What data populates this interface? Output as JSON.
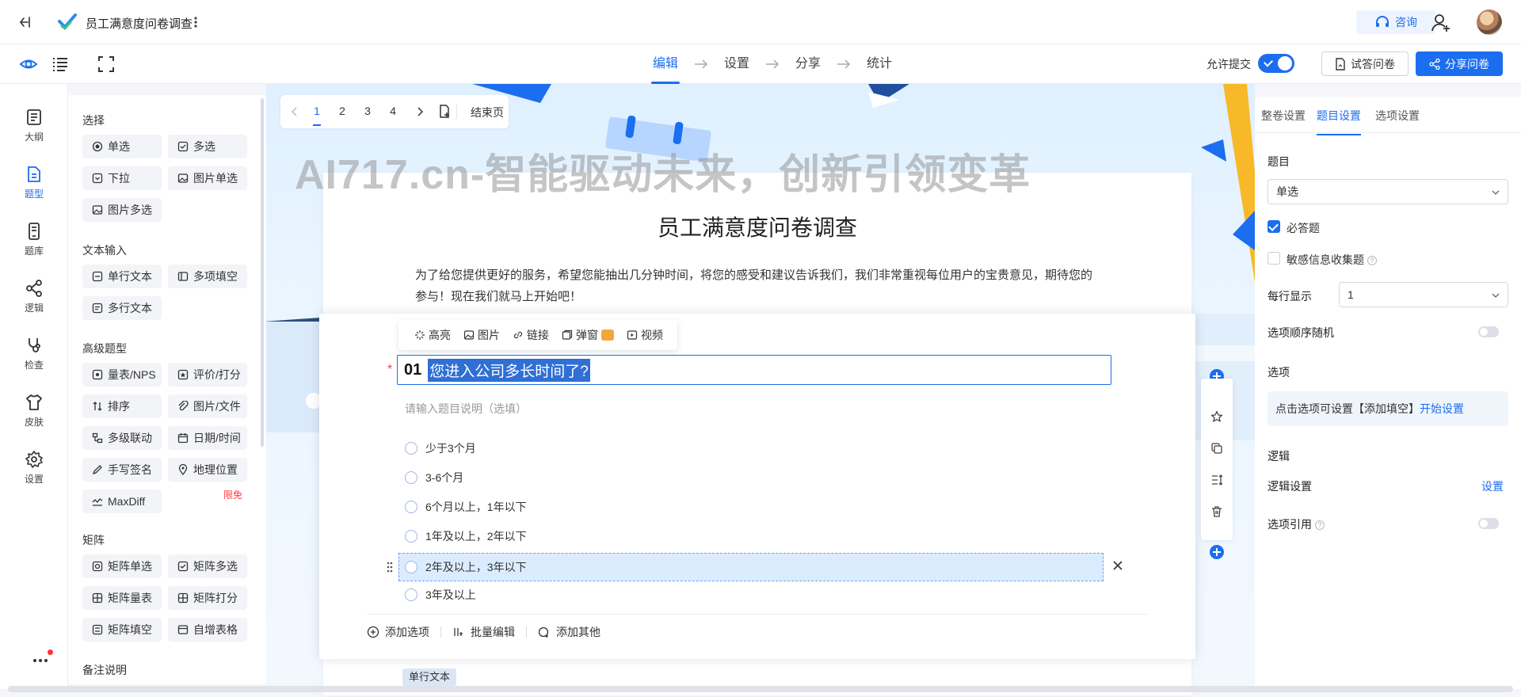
{
  "app": {
    "title": "员工满意度问卷调查"
  },
  "header": {
    "consult_label": "咨询",
    "steps": [
      "编辑",
      "设置",
      "分享",
      "统计"
    ],
    "allow_submit_label": "允许提交",
    "try_label": "试答问卷",
    "share_label": "分享问卷"
  },
  "rail": {
    "items": [
      "大纲",
      "题型",
      "题库",
      "逻辑",
      "检查",
      "皮肤",
      "设置"
    ]
  },
  "types": {
    "sections": [
      "选择",
      "文本输入",
      "高级题型",
      "矩阵",
      "备注说明"
    ],
    "choice": [
      "单选",
      "多选",
      "下拉",
      "图片单选",
      "图片多选"
    ],
    "text": [
      "单行文本",
      "多项填空",
      "多行文本"
    ],
    "advanced": [
      "量表/NPS",
      "评价/打分",
      "排序",
      "图片/文件",
      "多级联动",
      "日期/时间",
      "手写签名",
      "地理位置",
      "MaxDiff"
    ],
    "limit_badge": "限免",
    "matrix": [
      "矩阵单选",
      "矩阵多选",
      "矩阵量表",
      "矩阵打分",
      "矩阵填空",
      "自增表格"
    ]
  },
  "pagenav": {
    "pages": [
      "1",
      "2",
      "3",
      "4"
    ],
    "end_label": "结束页"
  },
  "watermark": "AI717.cn-智能驱动未来，创新引领变革",
  "survey": {
    "title": "员工满意度问卷调查",
    "description": "为了给您提供更好的服务，希望您能抽出几分钟时间，将您的感受和建议告诉我们，我们非常重视每位用户的宝贵意见，期待您的参与！现在我们就马上开始吧！"
  },
  "question": {
    "toolbar": [
      "高亮",
      "图片",
      "链接",
      "弹窗",
      "视频"
    ],
    "required_mark": "*",
    "number": "01",
    "text": "您进入公司多长时间了?",
    "desc_placeholder": "请输入题目说明（选填）",
    "options": [
      "少于3个月",
      "3-6个月",
      "6个月以上，1年以下",
      "1年及以上，2年以下",
      "2年及以上，3年以下",
      "3年及以上"
    ],
    "footer": [
      "添加选项",
      "批量编辑",
      "添加其他"
    ],
    "next_tag": "单行文本"
  },
  "settings": {
    "tabs": [
      "整卷设置",
      "题目设置",
      "选项设置"
    ],
    "question_label": "题目",
    "question_type": "单选",
    "required_label": "必答题",
    "required_checked": true,
    "sensitive_label": "敏感信息收集题",
    "sensitive_checked": false,
    "per_row_label": "每行显示",
    "per_row_value": "1",
    "random_label": "选项顺序随机",
    "options_label": "选项",
    "options_hint": "点击选项可设置【添加填空】",
    "options_link": "开始设置",
    "logic_label": "逻辑",
    "logic_setting_label": "逻辑设置",
    "logic_link": "设置",
    "option_ref_label": "选项引用"
  },
  "colors": {
    "accent": "#1a6eef",
    "required": "#f04848",
    "limit": "#ff3b3b"
  }
}
